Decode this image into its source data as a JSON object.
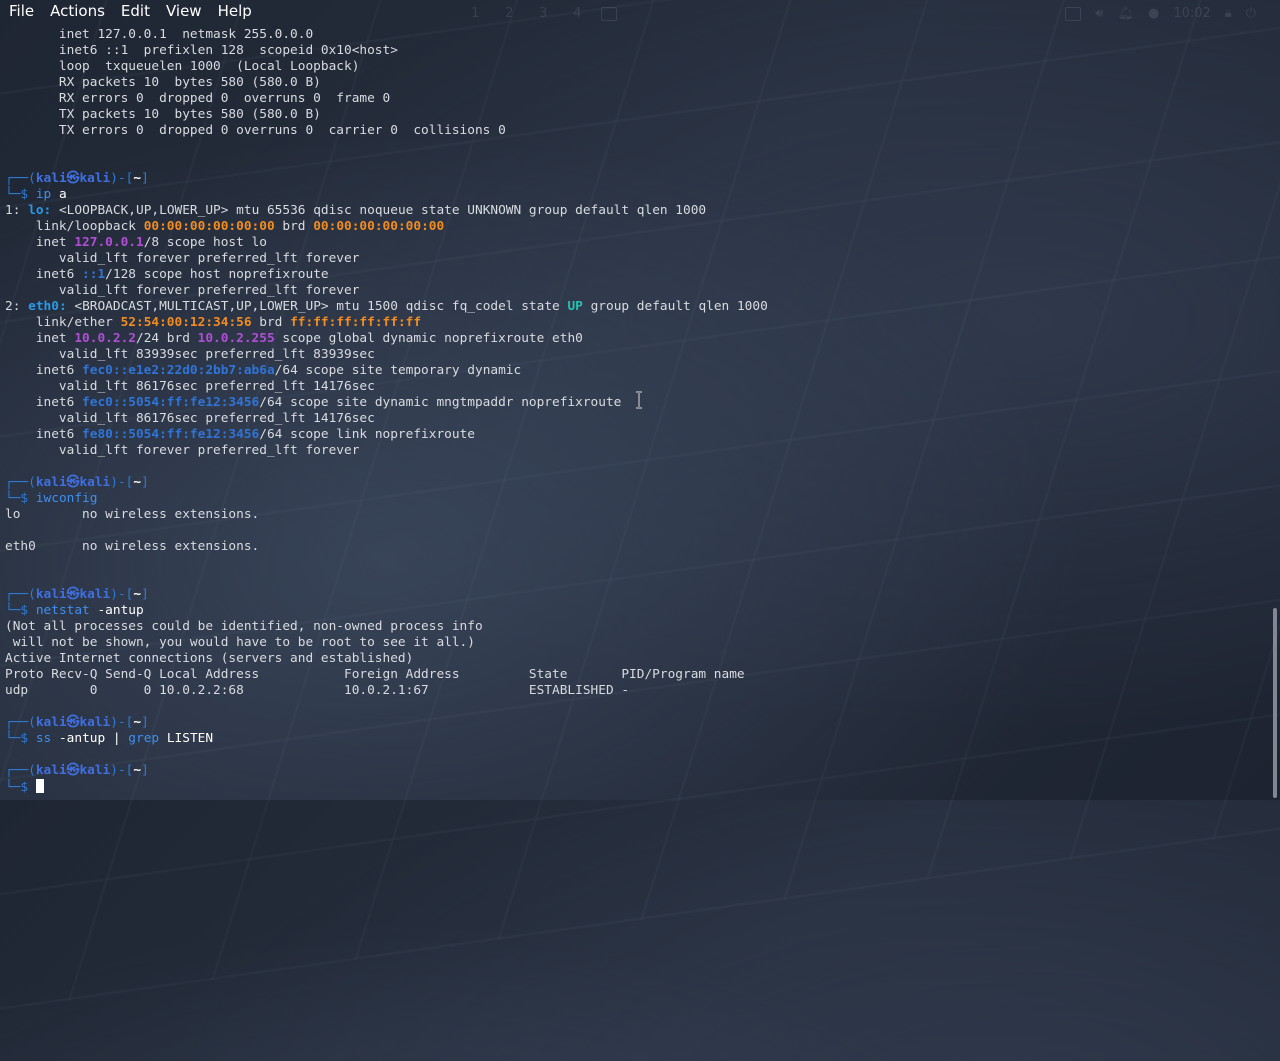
{
  "menubar": {
    "file": "File",
    "actions": "Actions",
    "edit": "Edit",
    "view": "View",
    "help": "Help"
  },
  "panel": {
    "workspaces": [
      "1",
      "2",
      "3",
      "4"
    ],
    "clock": "10:02"
  },
  "prompt": {
    "frame_open": "┌──(",
    "user": "kali㉿kali",
    "mid": ")-[",
    "dir": "~",
    "frame_close": "]",
    "line2": "└─$ "
  },
  "terminal": {
    "lo_top": [
      "       inet 127.0.0.1  netmask 255.0.0.0",
      "       inet6 ::1  prefixlen 128  scopeid 0x10<host>",
      "       loop  txqueuelen 1000  (Local Loopback)",
      "       RX packets 10  bytes 580 (580.0 B)",
      "       RX errors 0  dropped 0  overruns 0  frame 0",
      "       TX packets 10  bytes 580 (580.0 B)",
      "       TX errors 0  dropped 0 overruns 0  carrier 0  collisions 0"
    ],
    "cmd1": {
      "name": "ip",
      "args": " a"
    },
    "ip_a": {
      "lo_idx": "1: ",
      "lo_name": "lo:",
      "lo_flags": " <LOOPBACK,UP,LOWER_UP> mtu 65536 qdisc noqueue state UNKNOWN group default qlen 1000",
      "lo_link_pre": "    link/loopback ",
      "lo_mac": "00:00:00:00:00:00",
      "lo_brd_pre": " brd ",
      "lo_brd": "00:00:00:00:00:00",
      "lo_inet_pre": "    inet ",
      "lo_ip4": "127.0.0.1",
      "lo_inet_post": "/8 scope host lo",
      "lft_forever": "       valid_lft forever preferred_lft forever",
      "lo_inet6_pre": "    inet6 ",
      "lo_ip6": "::1",
      "lo_inet6_post": "/128 scope host noprefixroute",
      "eth_idx": "2: ",
      "eth_name": "eth0:",
      "eth_flags": " <BROADCAST,MULTICAST,UP,LOWER_UP> mtu 1500 qdisc fq_codel state ",
      "eth_state": "UP",
      "eth_flags_post": " group default qlen 1000",
      "eth_link_pre": "    link/ether ",
      "eth_mac": "52:54:00:12:34:56",
      "eth_brd_pre": " brd ",
      "eth_brd": "ff:ff:ff:ff:ff:ff",
      "eth_inet_pre": "    inet ",
      "eth_ip4": "10.0.2.2",
      "eth_inet_mid": "/24 brd ",
      "eth_bcast": "10.0.2.255",
      "eth_inet_post": " scope global dynamic noprefixroute eth0",
      "eth_lft1": "       valid_lft 83939sec preferred_lft 83939sec",
      "eth_inet6a_pre": "    inet6 ",
      "eth_ip6a": "fec0::e1e2:22d0:2bb7:ab6a",
      "eth_inet6a_post": "/64 scope site temporary dynamic",
      "eth_lft2": "       valid_lft 86176sec preferred_lft 14176sec",
      "eth_inet6b_pre": "    inet6 ",
      "eth_ip6b": "fec0::5054:ff:fe12:3456",
      "eth_inet6b_post": "/64 scope site dynamic mngtmpaddr noprefixroute",
      "eth_lft3": "       valid_lft 86176sec preferred_lft 14176sec",
      "eth_inet6c_pre": "    inet6 ",
      "eth_ip6c": "fe80::5054:ff:fe12:3456",
      "eth_inet6c_post": "/64 scope link noprefixroute",
      "eth_lft4": "       valid_lft forever preferred_lft forever"
    },
    "cmd2": {
      "name": "iwconfig",
      "args": ""
    },
    "iwconfig": [
      "lo        no wireless extensions.",
      "",
      "eth0      no wireless extensions."
    ],
    "cmd3": {
      "name": "netstat",
      "args": " -antup"
    },
    "netstat": [
      "(Not all processes could be identified, non-owned process info",
      " will not be shown, you would have to be root to see it all.)",
      "Active Internet connections (servers and established)",
      "Proto Recv-Q Send-Q Local Address           Foreign Address         State       PID/Program name",
      "udp        0      0 10.0.2.2:68             10.0.2.1:67             ESTABLISHED -"
    ],
    "cmd4": {
      "name": "ss",
      "args": " -antup | ",
      "pipe_name": "grep",
      "pipe_args": " LISTEN"
    }
  }
}
